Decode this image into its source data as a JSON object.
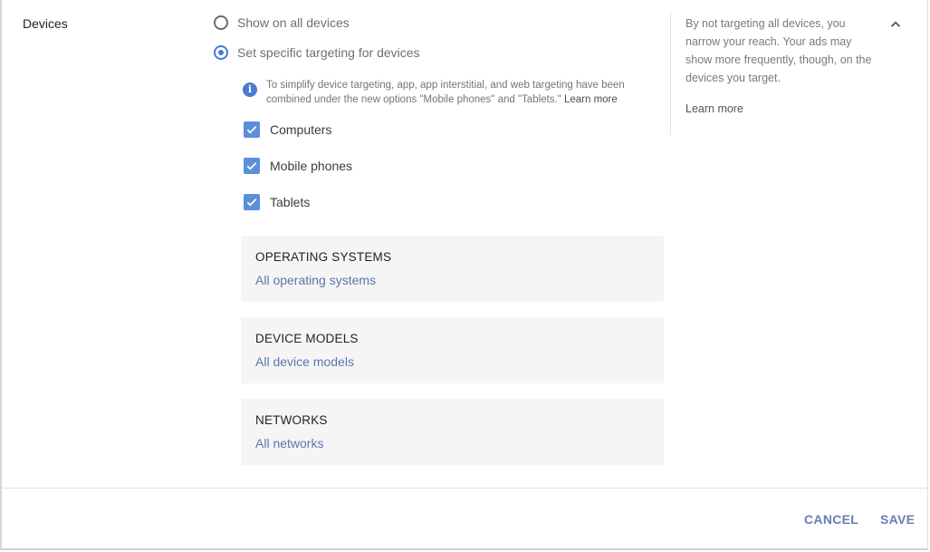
{
  "section": {
    "label": "Devices"
  },
  "targeting_options": [
    {
      "label": "Show on all devices",
      "selected": false
    },
    {
      "label": "Set specific targeting for devices",
      "selected": true
    }
  ],
  "info_notice": {
    "icon": "info-icon",
    "text": "To simplify device targeting, app, app interstitial, and web targeting have been combined under the new options \"Mobile phones\" and \"Tablets.\"",
    "link": "Learn more"
  },
  "devices": [
    {
      "label": "Computers",
      "checked": true
    },
    {
      "label": "Mobile phones",
      "checked": true
    },
    {
      "label": "Tablets",
      "checked": true
    }
  ],
  "panels": [
    {
      "title": "OPERATING SYSTEMS",
      "value": "All operating systems"
    },
    {
      "title": "DEVICE MODELS",
      "value": "All device models"
    },
    {
      "title": "NETWORKS",
      "value": "All networks"
    }
  ],
  "help": {
    "text": "By not targeting all devices, you narrow your reach. Your ads may show more frequently, though, on the devices you target.",
    "link": "Learn more",
    "collapse_icon": "chevron-up-icon"
  },
  "footer": {
    "cancel_label": "CANCEL",
    "save_label": "SAVE"
  },
  "colors": {
    "accent": "#4a7bd0",
    "checkbox": "#5b8fd9",
    "link": "#5a76b0",
    "panel_bg": "#f5f5f5"
  }
}
